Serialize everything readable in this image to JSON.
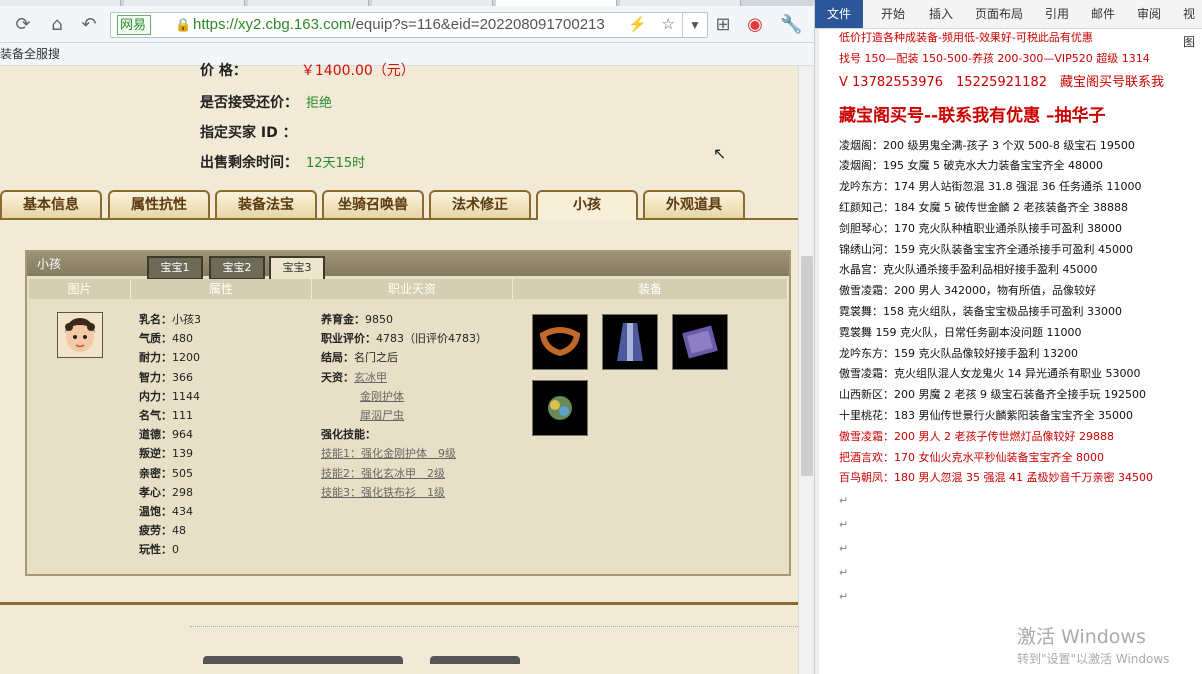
{
  "browser": {
    "site_badge": "网易",
    "url_host": "https://xy2.cbg.163.com",
    "url_path": "/equip?s=116&eid=202208091700213",
    "bookmark": "装备全服搜"
  },
  "sale": {
    "price_label": "价 格：",
    "price_value": "￥1400.00（元）",
    "counter_offer_label": "是否接受还价：",
    "counter_offer_value": "拒绝",
    "buyer_label": "指定买家 ID ：",
    "buyer_value": "",
    "remaining_label": "出售剩余时间：",
    "remaining_value": "12天15时"
  },
  "tabs": [
    "基本信息",
    "属性抗性",
    "装备法宝",
    "坐骑召唤兽",
    "法术修正",
    "小孩",
    "外观道具"
  ],
  "child_panel": {
    "title": "小孩",
    "subtabs": [
      "宝宝1",
      "宝宝2",
      "宝宝3"
    ],
    "columns": [
      "图片",
      "属性",
      "职业天资",
      "装备"
    ],
    "attributes": [
      {
        "label": "乳名：",
        "value": "小孩3"
      },
      {
        "label": "气质：",
        "value": "480"
      },
      {
        "label": "耐力：",
        "value": "1200"
      },
      {
        "label": "智力：",
        "value": "366"
      },
      {
        "label": "内力：",
        "value": "1144"
      },
      {
        "label": "名气：",
        "value": "111"
      },
      {
        "label": "道德：",
        "value": "964"
      },
      {
        "label": "叛逆：",
        "value": "139"
      },
      {
        "label": "亲密：",
        "value": "505"
      },
      {
        "label": "孝心：",
        "value": "298"
      },
      {
        "label": "温饱：",
        "value": "434"
      },
      {
        "label": "疲劳：",
        "value": "48"
      },
      {
        "label": "玩性：",
        "value": "0"
      }
    ],
    "job": {
      "nurture_label": "养育金：",
      "nurture_value": "9850",
      "rating_label": "职业评价：",
      "rating_value": "4783（旧评价4783）",
      "ending_label": "结局：",
      "ending_value": "名门之后",
      "talent_label": "天资：",
      "talents": [
        "玄冰甲",
        "金刚护体",
        "犀泅尸虫"
      ],
      "skills_label": "强化技能：",
      "skills": [
        "技能1：强化金刚护体　9级",
        "技能2：强化玄冰甲　2级",
        "技能3：强化铁布衫　1级"
      ]
    }
  },
  "word": {
    "ribbon": [
      "文件",
      "开始",
      "插入",
      "页面布局",
      "引用",
      "邮件",
      "审阅",
      "视图"
    ],
    "lines": [
      {
        "text": "低价打造各种成装备-频用低-效果好-可税此品有优惠",
        "style": "red"
      },
      {
        "text": "找号 150—配装 150-500-养孩 200-300—VIP520 超级 1314",
        "style": "red"
      },
      {
        "text": "V 13782553976　15225921182　藏宝阁买号联系我",
        "style": "red big"
      },
      {
        "text": "藏宝阁买号--联系我有优惠 –抽华子",
        "style": "red huge"
      },
      {
        "text": "凌烟阁：200 级男鬼全满-孩子 3 个双 500-8 级宝石 19500",
        "style": ""
      },
      {
        "text": "凌烟阁：195 女魔 5 破克水大力装备宝宝齐全 48000",
        "style": ""
      },
      {
        "text": "龙吟东方：174 男人站街忽混 31.8 强混 36 任务通杀 11000",
        "style": ""
      },
      {
        "text": "红颜知己：184 女魔 5 破传世金麟 2 老孩装备齐全 38888",
        "style": ""
      },
      {
        "text": "剑胆琴心：170 克火队种植职业通杀队接手可盈利 38000",
        "style": ""
      },
      {
        "text": "锦绣山河：159 克火队装备宝宝齐全通杀接手可盈利 45000",
        "style": ""
      },
      {
        "text": "水晶宫：克火队通杀接手盈利品相好接手盈利 45000",
        "style": ""
      },
      {
        "text": "傲雪凌霜：200 男人 342000，物有所值，品像较好",
        "style": ""
      },
      {
        "text": "霓裳舞：158 克火组队，装备宝宝极品接手可盈利 33000",
        "style": ""
      },
      {
        "text": "霓裳舞 159 克火队，日常任务副本没问题 11000",
        "style": ""
      },
      {
        "text": "龙吟东方：159 克火队品像较好接手盈利 13200",
        "style": ""
      },
      {
        "text": "傲雪凌霜：克火组队混人女龙鬼火 14 异光通杀有职业 53000",
        "style": ""
      },
      {
        "text": "山西新区：200 男魔 2 老孩 9 级宝石装备齐全接手玩 192500",
        "style": ""
      },
      {
        "text": "十里桃花：183 男仙传世景行火麟紫阳装备宝宝齐全 35000",
        "style": ""
      },
      {
        "text": "傲雪凌霜：200 男人 2 老孩子传世燃灯品像较好 29888",
        "style": "red"
      },
      {
        "text": "把酒言欢：170 女仙火克水平秒仙装备宝宝齐全 8000",
        "style": "red"
      },
      {
        "text": "百鸟朝凤：180 男人忽混 35 强混 41 孟极妙音千万亲密 34500",
        "style": "red"
      }
    ],
    "watermark_title": "激活 Windows",
    "watermark_sub": "转到\"设置\"以激活 Windows"
  }
}
